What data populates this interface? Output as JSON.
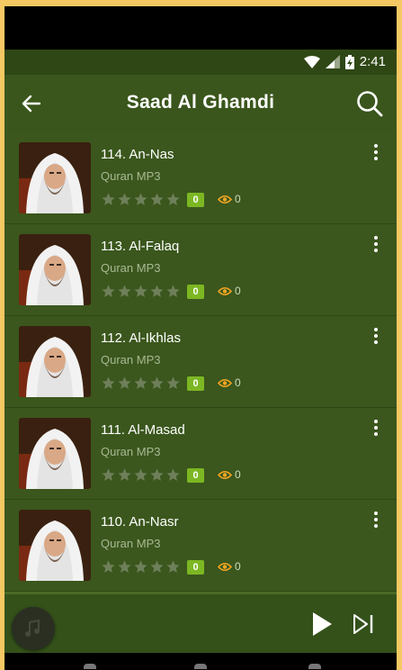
{
  "status": {
    "time": "2:41"
  },
  "appbar": {
    "title": "Saad Al Ghamdi"
  },
  "list": {
    "items": [
      {
        "title": "114. An-Nas",
        "subtitle": "Quran MP3",
        "badge": "0",
        "views": "0",
        "rating": 0
      },
      {
        "title": "113. Al-Falaq",
        "subtitle": "Quran MP3",
        "badge": "0",
        "views": "0",
        "rating": 0
      },
      {
        "title": "112. Al-Ikhlas",
        "subtitle": "Quran MP3",
        "badge": "0",
        "views": "0",
        "rating": 0
      },
      {
        "title": "111. Al-Masad",
        "subtitle": "Quran MP3",
        "badge": "0",
        "views": "0",
        "rating": 0
      },
      {
        "title": "110. An-Nasr",
        "subtitle": "Quran MP3",
        "badge": "0",
        "views": "0",
        "rating": 0
      }
    ]
  },
  "colors": {
    "appbar": "#3a561c",
    "statusbar": "#2f4715",
    "badge": "#7cb723",
    "eye": "#f5a623",
    "frame": "#f4c862"
  },
  "icons": {
    "back": "arrow-left-icon",
    "search": "search-icon",
    "menu": "more-vert-icon",
    "star": "star-icon",
    "views": "eye-icon",
    "play": "play-icon",
    "next": "skip-next-icon",
    "disc": "music-note-icon"
  }
}
